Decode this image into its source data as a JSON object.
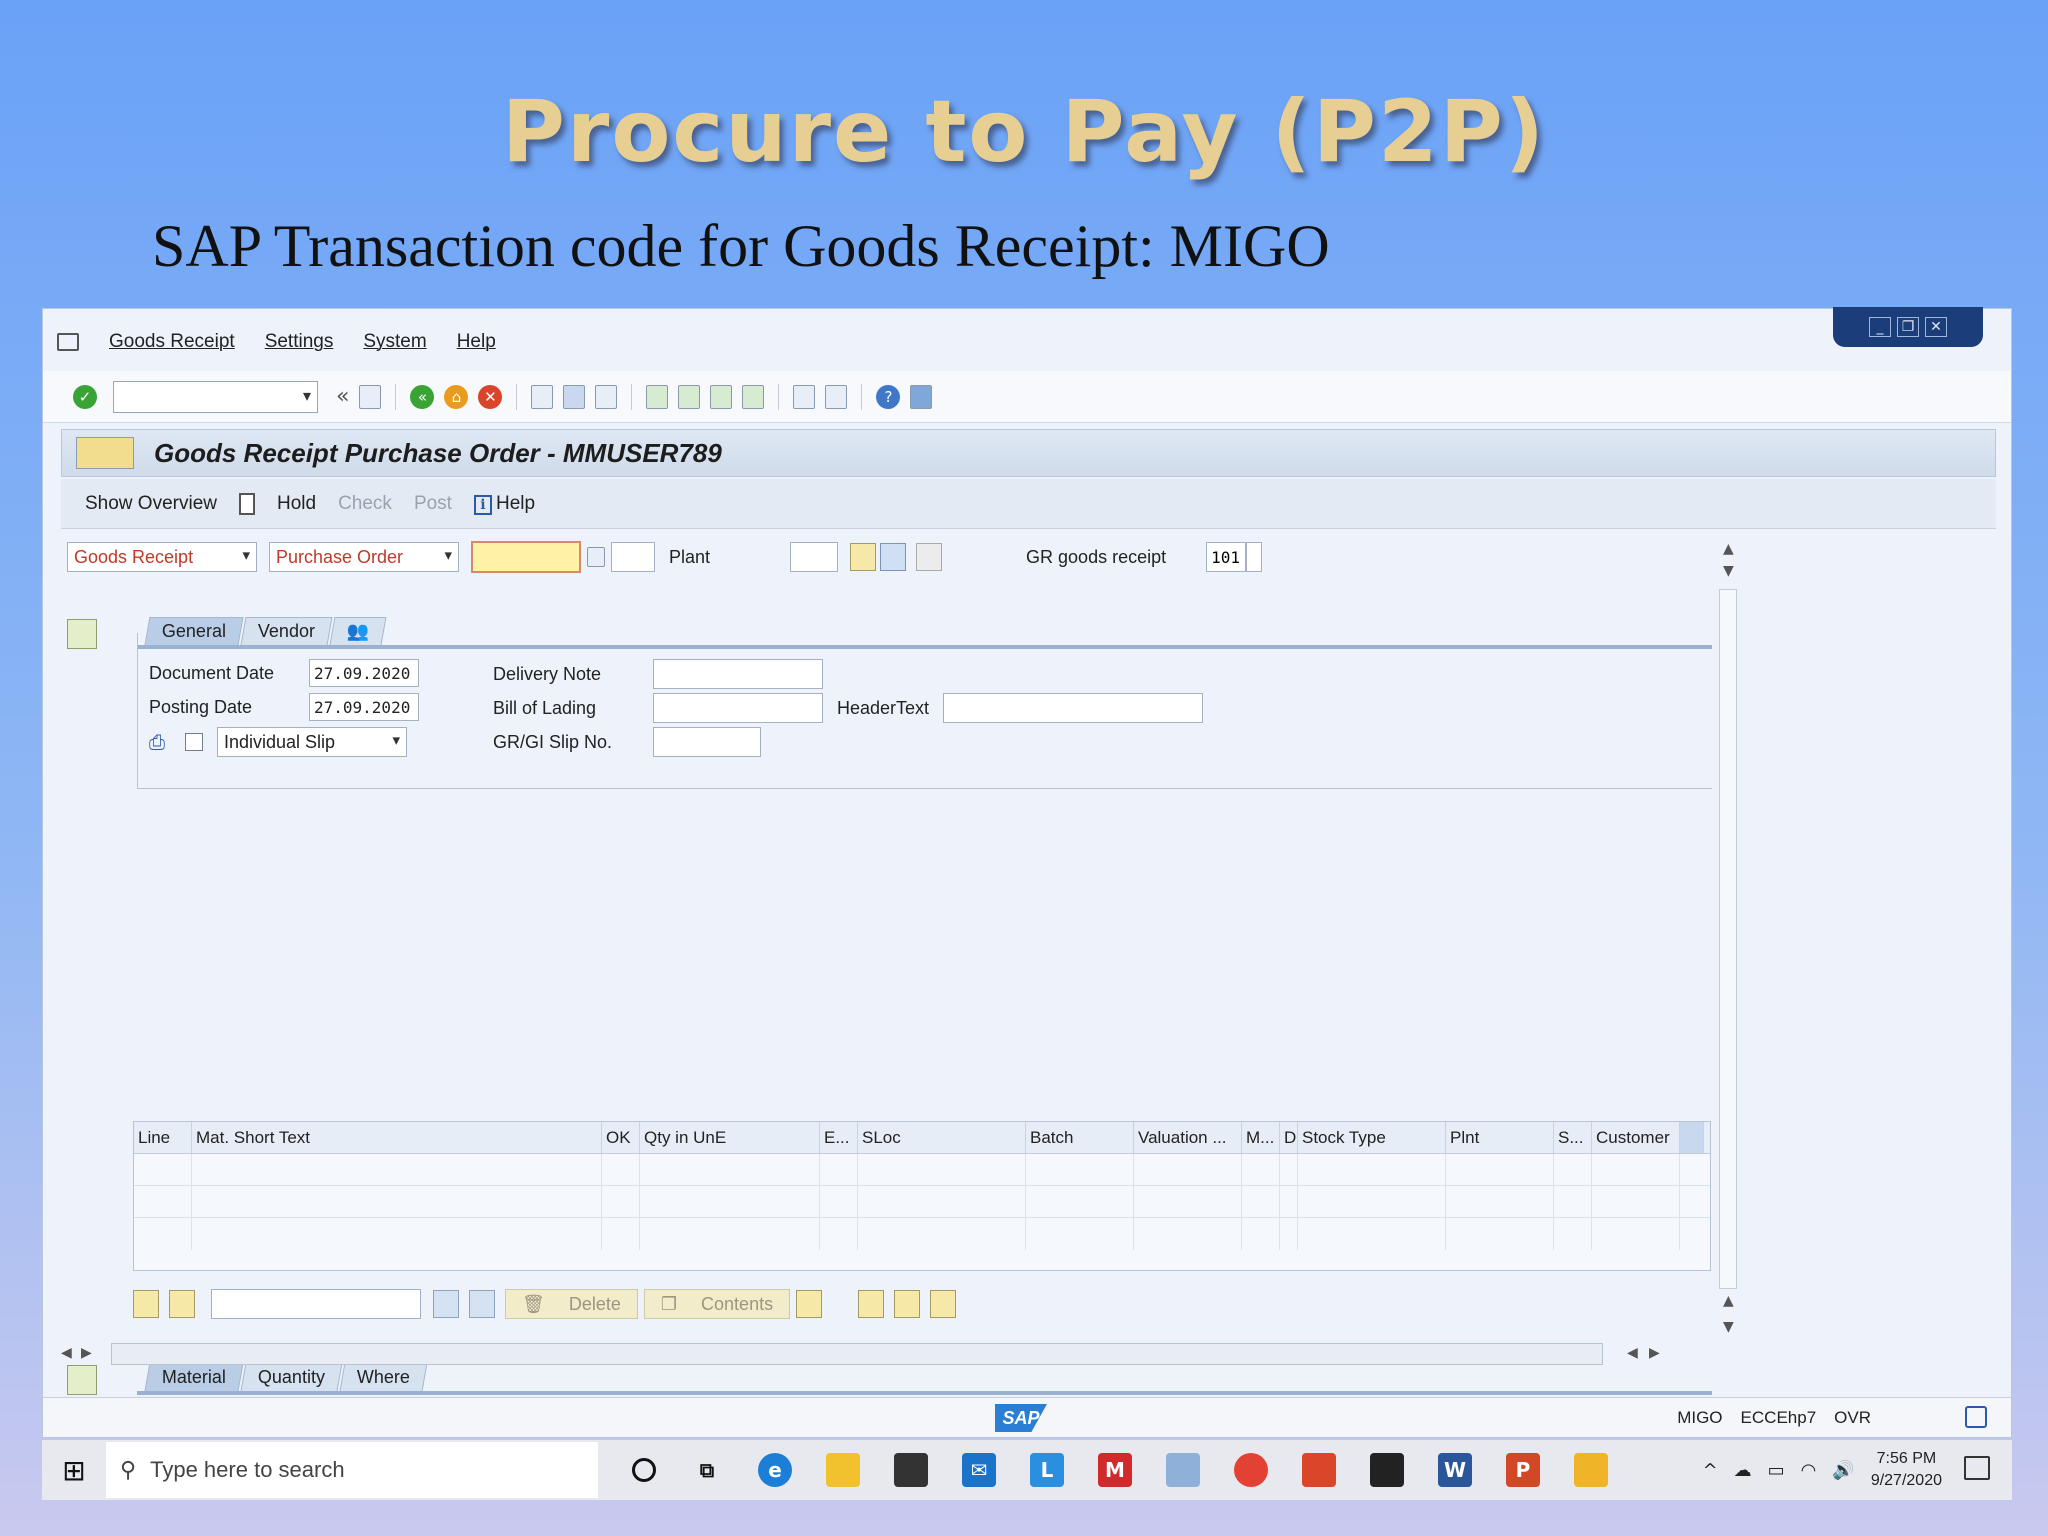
{
  "slide": {
    "title": "Procure to Pay (P2P)",
    "subtitle": "SAP Transaction code for Goods Receipt: MIGO"
  },
  "menu": {
    "items": [
      "Goods Receipt",
      "Settings",
      "System",
      "Help"
    ]
  },
  "toolbar": {
    "nav_back": "«"
  },
  "screen": {
    "title": "Goods Receipt Purchase Order - MMUSER789"
  },
  "app_toolbar": {
    "show_overview": "Show Overview",
    "hold": "Hold",
    "check": "Check",
    "post": "Post",
    "help": "Help"
  },
  "selection": {
    "action": "Goods Receipt",
    "reference": "Purchase Order",
    "plant_label": "Plant",
    "movement_label": "GR goods receipt",
    "movement_type": "101"
  },
  "header_tabs": [
    "General",
    "Vendor"
  ],
  "general": {
    "document_date_label": "Document Date",
    "document_date": "27.09.2020",
    "posting_date_label": "Posting Date",
    "posting_date": "27.09.2020",
    "slip_type": "Individual Slip",
    "delivery_note_label": "Delivery Note",
    "bill_of_lading_label": "Bill of Lading",
    "gr_gi_slip_label": "GR/GI Slip No.",
    "header_text_label": "HeaderText"
  },
  "grid": {
    "columns": [
      "Line",
      "Mat. Short Text",
      "OK",
      "Qty in UnE",
      "E...",
      "SLoc",
      "Batch",
      "Valuation ...",
      "M...",
      "D",
      "Stock Type",
      "Plnt",
      "S...",
      "Customer"
    ]
  },
  "item_tools": {
    "delete": "Delete",
    "contents": "Contents"
  },
  "detail_tabs": [
    "Material",
    "Quantity",
    "Where"
  ],
  "status": {
    "logo": "SAP",
    "transaction": "MIGO",
    "system": "ECCEhp7",
    "mode": "OVR"
  },
  "taskbar": {
    "search_placeholder": "Type here to search",
    "time": "7:56 PM",
    "date": "9/27/2020"
  },
  "colors": {
    "background_top": "#6aa2f7",
    "title_gold": "#e7cf93",
    "sap_blue": "#2a7fd4",
    "required_red": "#c0392b"
  }
}
